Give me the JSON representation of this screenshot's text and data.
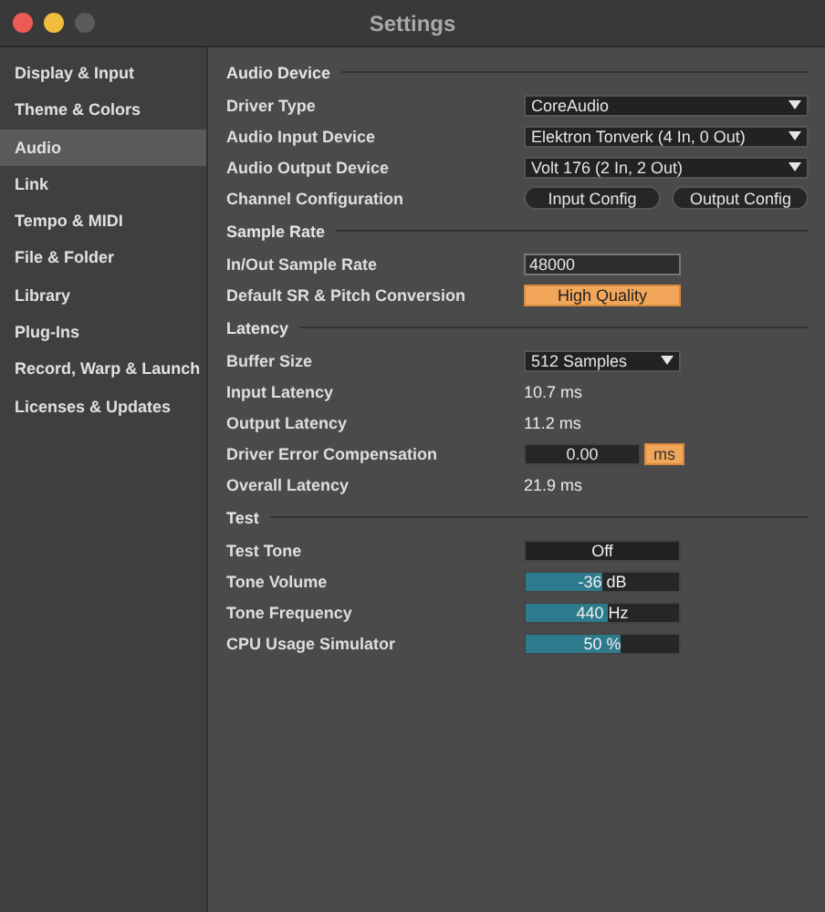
{
  "window": {
    "title": "Settings"
  },
  "sidebar": {
    "items": [
      {
        "label": "Display & Input",
        "selected": false
      },
      {
        "label": "Theme & Colors",
        "selected": false
      },
      {
        "label": "Audio",
        "selected": true
      },
      {
        "label": "Link",
        "selected": false
      },
      {
        "label": "Tempo & MIDI",
        "selected": false
      },
      {
        "label": "File & Folder",
        "selected": false
      },
      {
        "label": "Library",
        "selected": false
      },
      {
        "label": "Plug-Ins",
        "selected": false
      },
      {
        "label": "Record, Warp & Launch",
        "selected": false
      },
      {
        "label": "Licenses & Updates",
        "selected": false
      }
    ]
  },
  "sections": [
    {
      "title": "Audio Device",
      "rows": [
        {
          "kind": "dropdown",
          "label": "Driver Type",
          "value": "CoreAudio"
        },
        {
          "kind": "dropdown",
          "label": "Audio Input Device",
          "value": "Elektron Tonverk (4 In, 0 Out)"
        },
        {
          "kind": "dropdown",
          "label": "Audio Output Device",
          "value": "Volt 176 (2 In, 2 Out)"
        },
        {
          "kind": "buttons",
          "label": "Channel Configuration",
          "buttons": [
            "Input Config",
            "Output Config"
          ]
        }
      ]
    },
    {
      "title": "Sample Rate",
      "rows": [
        {
          "kind": "field",
          "label": "In/Out Sample Rate",
          "value": "48000"
        },
        {
          "kind": "toggle",
          "label": "Default SR & Pitch Conversion",
          "value": "High Quality",
          "on": true
        }
      ]
    },
    {
      "title": "Latency",
      "rows": [
        {
          "kind": "short-dropdown",
          "label": "Buffer Size",
          "value": "512 Samples"
        },
        {
          "kind": "value",
          "label": "Input Latency",
          "value": "10.7 ms"
        },
        {
          "kind": "value",
          "label": "Output Latency",
          "value": "11.2 ms"
        },
        {
          "kind": "field-unit",
          "label": "Driver Error Compensation",
          "value": "0.00",
          "unit": "ms",
          "unit_on": true
        },
        {
          "kind": "value",
          "label": "Overall Latency",
          "value": "21.9 ms"
        }
      ]
    },
    {
      "title": "Test",
      "rows": [
        {
          "kind": "toggle",
          "label": "Test Tone",
          "value": "Off",
          "on": false
        },
        {
          "kind": "slider",
          "label": "Tone Volume",
          "value": "-36 dB",
          "level": 0.5
        },
        {
          "kind": "slider",
          "label": "Tone Frequency",
          "value": "440 Hz",
          "level": 0.54
        },
        {
          "kind": "slider",
          "label": "CPU Usage Simulator",
          "value": "50 %",
          "level": 0.62
        }
      ]
    }
  ]
}
